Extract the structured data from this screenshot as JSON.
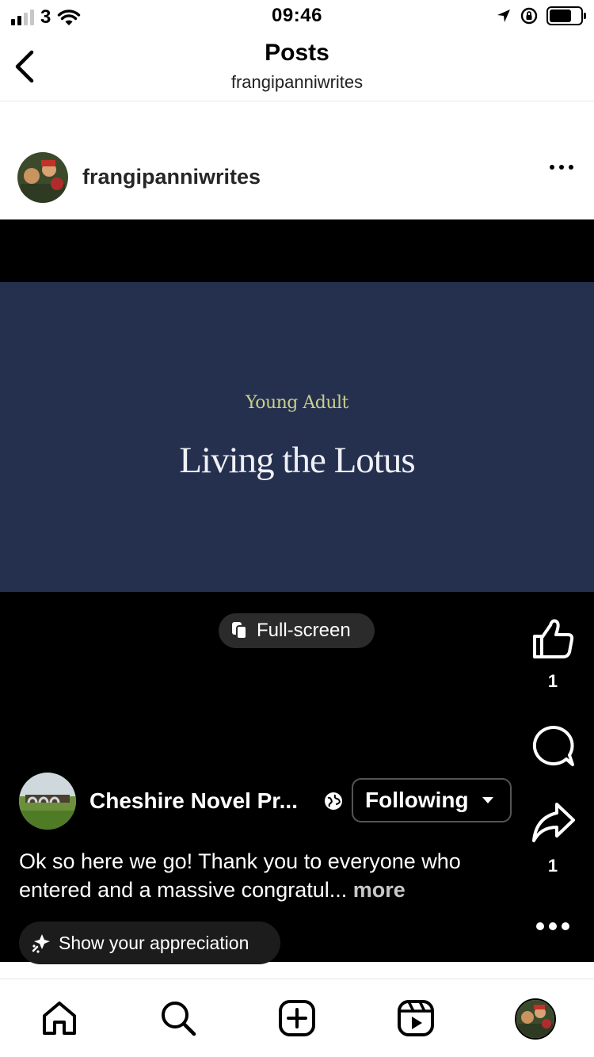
{
  "status": {
    "carrier": "3",
    "time": "09:46"
  },
  "nav": {
    "title": "Posts",
    "subtitle": "frangipanniwrites"
  },
  "post": {
    "username": "frangipanniwrites",
    "banner_category": "Young Adult",
    "banner_title": "Living the Lotus",
    "fullscreen_label": "Full-screen",
    "like_count": "1",
    "share_count": "1",
    "author_name": "Cheshire Novel Pr...",
    "following_label": "Following",
    "caption_text": "Ok so here we go! Thank you to everyone who entered and a massive congratul... ",
    "caption_more": "more",
    "appreciate_label": "Show your appreciation"
  },
  "colors": {
    "banner_bg": "#25304f",
    "banner_category": "#c9cf8b",
    "banner_title": "#eef0f5"
  },
  "icons": {
    "back": "chevron-left-icon",
    "more": "more-horizontal-icon",
    "fullscreen": "fullscreen-icon",
    "like": "thumbs-up-icon",
    "comment": "comment-icon",
    "share": "share-icon",
    "globe": "globe-icon",
    "dropdown": "caret-down-icon",
    "appreciate": "sparkle-icon",
    "tabs": [
      "home-icon",
      "search-icon",
      "create-icon",
      "reels-icon",
      "profile-avatar"
    ]
  }
}
